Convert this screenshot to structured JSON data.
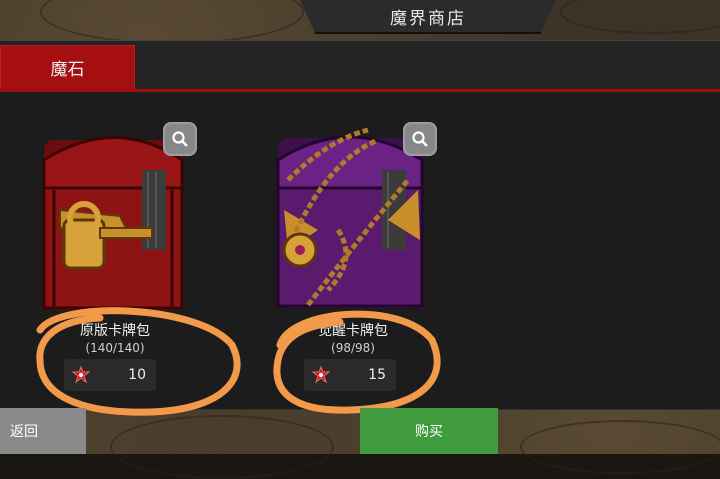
{
  "shop": {
    "title": "魔界商店"
  },
  "tabs": [
    {
      "label": "魔石",
      "active": true
    }
  ],
  "items": [
    {
      "name": "原版卡牌包",
      "stock": "(140/140)",
      "price": "10",
      "chest_color": "#8e1414",
      "icon": "zoom-icon"
    },
    {
      "name": "觉醒卡牌包",
      "stock": "(98/98)",
      "price": "15",
      "chest_color": "#5a1a6e",
      "icon": "zoom-icon"
    }
  ],
  "footer": {
    "back_label": "返回",
    "buy_label": "购买"
  },
  "colors": {
    "tab_active": "#a50f12",
    "buy_button": "#3f9b3e",
    "back_button": "#8a8a8a",
    "annotation": "#f29a4a"
  }
}
